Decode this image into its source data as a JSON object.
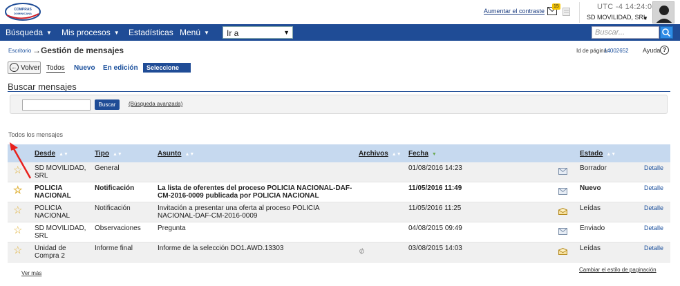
{
  "header": {
    "logo_text": "COMPRAS DOMINICANA",
    "contrast_link": "Aumentar el contraste",
    "mail_count": "15",
    "clock": "UTC -4 14:24:03",
    "organization": "SD MOVILIDAD, SRL"
  },
  "nav": {
    "items": [
      {
        "label": "Búsqueda",
        "dropdown": true
      },
      {
        "label": "Mis procesos",
        "dropdown": true
      },
      {
        "label": "Estadísticas",
        "dropdown": false
      },
      {
        "label": "Menú",
        "dropdown": true
      }
    ],
    "goto_value": "Ir a",
    "search_placeholder": "Buscar..."
  },
  "breadcrumb": {
    "root": "Escritorio",
    "arrow": "→",
    "title": "Gestión de mensajes",
    "page_id_label": "Id de página::",
    "page_id_value": "14002652",
    "help_label": "Ayuda",
    "help_glyph": "?"
  },
  "toolbar": {
    "back_label": "Volver",
    "tabs": [
      "Todos",
      "Nuevo",
      "En edición"
    ],
    "select_value": "Seleccione"
  },
  "search": {
    "section_title": "Buscar mensajes",
    "button_label": "Buscar",
    "advanced_link": "(Búsqueda avanzada)"
  },
  "messages": {
    "section_label": "Todos los mensajes",
    "columns": [
      "Desde",
      "Tipo",
      "Asunto",
      "Archivos",
      "Fecha",
      "Estado"
    ],
    "rows": [
      {
        "desde": "SD MOVILIDAD, SRL",
        "tipo": "General",
        "asunto": "",
        "attachment": false,
        "fecha": "01/08/2016 14:23",
        "estado": "Borrador",
        "detalle": "Detalle",
        "unread": false
      },
      {
        "desde": "POLICIA NACIONAL",
        "tipo": "Notificación",
        "asunto": "La lista de oferentes del proceso POLICIA NACIONAL-DAF-CM-2016-0009 publicada por POLICIA NACIONAL",
        "attachment": false,
        "fecha": "11/05/2016 11:49",
        "estado": "Nuevo",
        "detalle": "Detalle",
        "unread": true
      },
      {
        "desde": "POLICIA NACIONAL",
        "tipo": "Notificación",
        "asunto": "Invitación a presentar una oferta al proceso POLICIA NACIONAL-DAF-CM-2016-0009",
        "attachment": false,
        "fecha": "11/05/2016 11:25",
        "estado": "Leídas",
        "detalle": "Detalle",
        "unread": false
      },
      {
        "desde": "SD MOVILIDAD, SRL",
        "tipo": "Observaciones",
        "asunto": "Pregunta",
        "attachment": false,
        "fecha": "04/08/2015 09:49",
        "estado": "Enviado",
        "detalle": "Detalle",
        "unread": false
      },
      {
        "desde": "Unidad de Compra 2",
        "tipo": "Informe final",
        "asunto": "Informe de la selección DO1.AWD.13303",
        "attachment": true,
        "fecha": "03/08/2015 14:03",
        "estado": "Leídas",
        "detalle": "Detalle",
        "unread": false
      }
    ],
    "more_link": "Ver más",
    "pagination_link": "Cambiar el estilo de paginación"
  },
  "colors": {
    "nav_bg": "#1f4c96",
    "header_row_bg": "#c6d9ef",
    "link": "#1a4f9c",
    "star": "#e0b23a",
    "annotation_arrow": "#e8201c"
  }
}
